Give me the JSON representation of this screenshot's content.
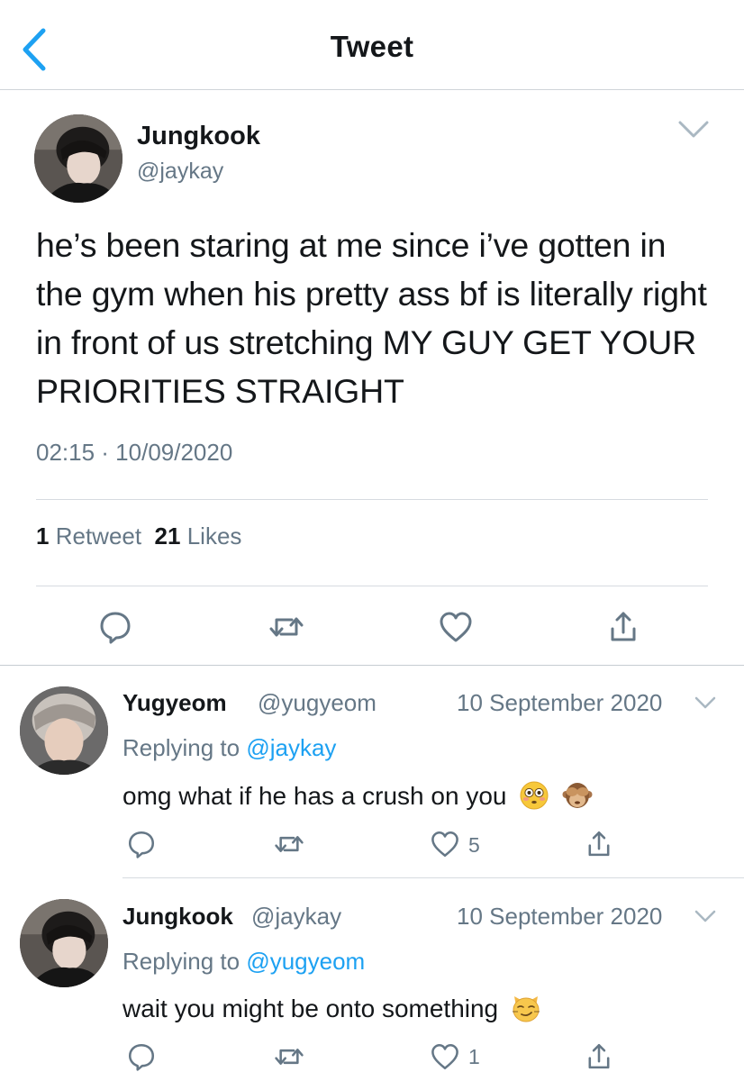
{
  "header": {
    "title": "Tweet"
  },
  "tweet": {
    "name": "Jungkook",
    "handle": "@jaykay",
    "text": "he’s been staring at me since i’ve gotten in the gym when his pretty ass bf is literally right in front of us stretching MY GUY GET YOUR PRIORITIES STRAIGHT",
    "time": "02:15 · 10/09/2020",
    "retweet_count": "1",
    "retweet_label": "Retweet",
    "like_count": "21",
    "like_label": "Likes"
  },
  "replies": [
    {
      "name": "Yugyeom",
      "handle": "@yugyeom",
      "date": "10 September 2020",
      "replying_prefix": "Replying to ",
      "replying_to": "@jaykay",
      "text": "omg what if he has a crush on you",
      "emojis": [
        "flushed-face",
        "see-no-evil-monkey"
      ],
      "like_count": "5"
    },
    {
      "name": "Jungkook",
      "handle": "@jaykay",
      "date": "10 September 2020",
      "replying_prefix": "Replying to ",
      "replying_to": "@yugyeom",
      "text": "wait you might be onto something",
      "emojis": [
        "smirking-cat"
      ],
      "like_count": "1"
    }
  ],
  "colors": {
    "accent": "#1da1f2",
    "secondary_text": "#657786",
    "icon": "#657786"
  }
}
